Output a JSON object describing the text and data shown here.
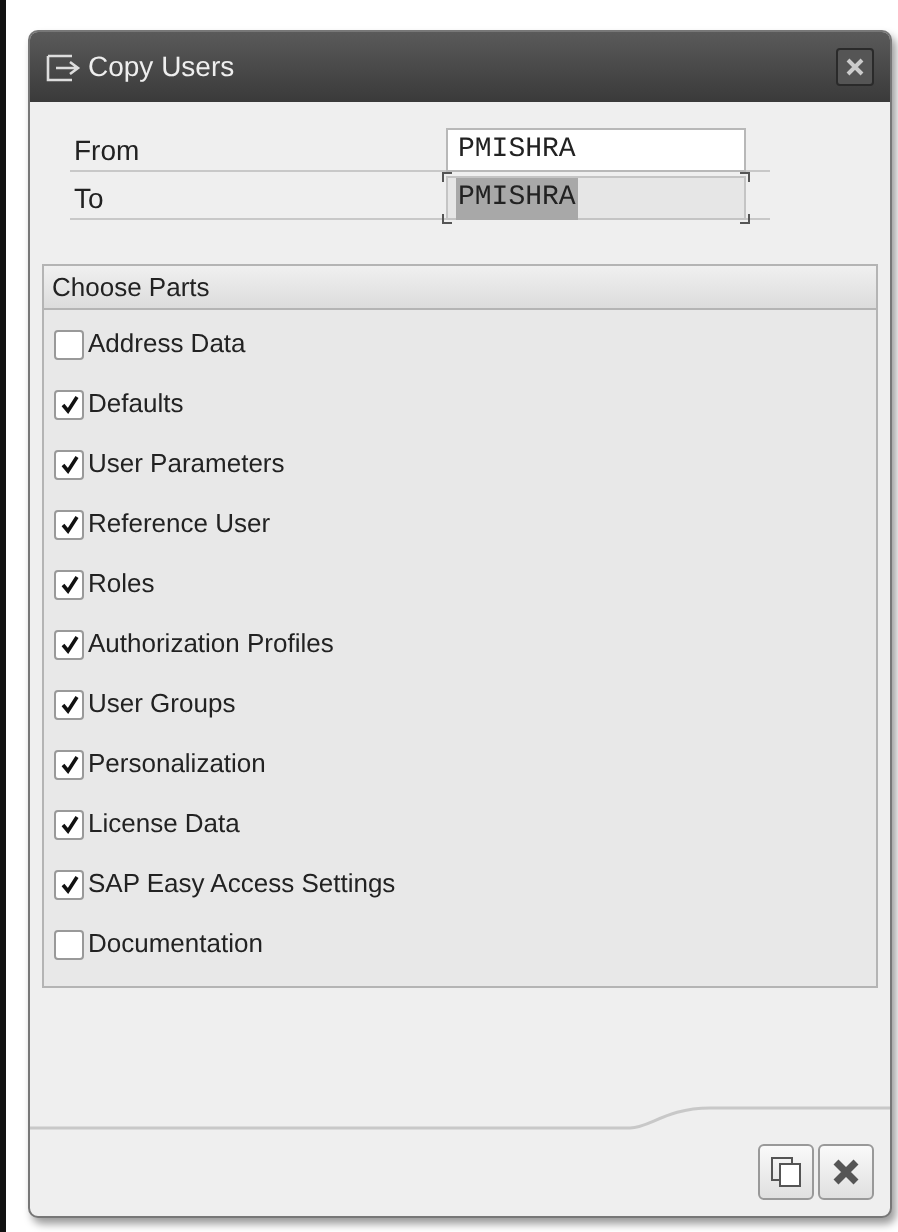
{
  "window": {
    "title": "Copy Users"
  },
  "fields": [
    {
      "label": "From",
      "value": "PMISHRA",
      "focused": false
    },
    {
      "label": "To",
      "value": "PMISHRA",
      "focused": true
    }
  ],
  "group": {
    "title": "Choose Parts",
    "items": [
      {
        "label": "Address Data",
        "checked": false
      },
      {
        "label": "Defaults",
        "checked": true
      },
      {
        "label": "User Parameters",
        "checked": true
      },
      {
        "label": "Reference User",
        "checked": true
      },
      {
        "label": "Roles",
        "checked": true
      },
      {
        "label": "Authorization Profiles",
        "checked": true
      },
      {
        "label": "User Groups",
        "checked": true
      },
      {
        "label": "Personalization",
        "checked": true
      },
      {
        "label": "License Data",
        "checked": true
      },
      {
        "label": "SAP Easy Access Settings",
        "checked": true
      },
      {
        "label": "Documentation",
        "checked": false
      }
    ]
  }
}
